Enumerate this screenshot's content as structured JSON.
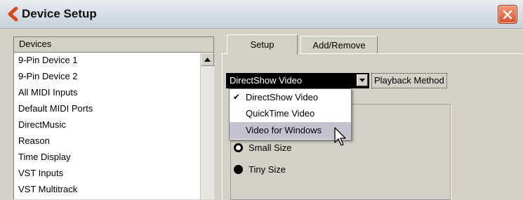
{
  "window": {
    "title": "Device Setup"
  },
  "devices": {
    "header": "Devices",
    "items": [
      "9-Pin Device 1",
      "9-Pin Device 2",
      "All MIDI Inputs",
      "Default MIDI Ports",
      "DirectMusic",
      "Reason",
      "Time Display",
      "VST Inputs",
      "VST Multitrack"
    ]
  },
  "tabs": [
    {
      "label": "Setup",
      "active": true
    },
    {
      "label": "Add/Remove",
      "active": false
    }
  ],
  "playback": {
    "selected": "DirectShow Video",
    "label": "Playback Method",
    "options": [
      {
        "label": "DirectShow Video",
        "checked": true,
        "highlighted": false
      },
      {
        "label": "QuickTime Video",
        "checked": false,
        "highlighted": false
      },
      {
        "label": "Video for Windows",
        "checked": false,
        "highlighted": true
      }
    ]
  },
  "size_options": [
    {
      "label": "Small Size",
      "state": "ring"
    },
    {
      "label": "Tiny Size",
      "state": "filled"
    }
  ],
  "colors": {
    "close_button": "#d9502a",
    "app_icon": "#d44a1c",
    "menu_highlight": "#c6c1d0"
  }
}
